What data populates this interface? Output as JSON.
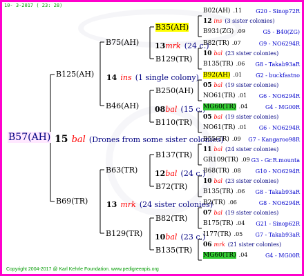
{
  "header": {
    "date": "10-  3-2017 ( 23: 28)"
  },
  "footer": {
    "text": "Copyright 2004-2017 @ Karl Kehrle Foundation.   www.pedigreeapis.org"
  },
  "root": {
    "id": "B57(AH)",
    "mating": {
      "year": "15",
      "type": "bal",
      "note": "(Drones from some sister colonies)"
    }
  },
  "gen1": [
    {
      "id": "B125(AH)",
      "mating": {
        "year": "14",
        "type": "ins",
        "note": "(1 single colony)"
      }
    },
    {
      "id": "B69(TR)",
      "mating": {
        "year": "13",
        "type": "mrk",
        "note": "(24 sister colonies)"
      }
    }
  ],
  "gen2": [
    {
      "id": "B75(AH)",
      "mating": {
        "year": "13",
        "type": "mrk",
        "note": "(24 c.)"
      }
    },
    {
      "id": "B46(AH)",
      "mating": {
        "year": "08",
        "type": "bal",
        "note": "(15 c.)"
      }
    },
    {
      "id": "B63(TR)",
      "mating": {
        "year": "12",
        "type": "bal",
        "note": "(24 c.)"
      }
    },
    {
      "id": "B129(TR)",
      "mating": {
        "year": "10",
        "type": "bal",
        "note": "(23 c.)"
      }
    }
  ],
  "gen3": [
    {
      "id": "B35(AH)"
    },
    {
      "id": "B129(TR)"
    },
    {
      "id": "B250(AH)"
    },
    {
      "id": "B110(TR)"
    },
    {
      "id": "B137(TR)"
    },
    {
      "id": "B72(TR)"
    },
    {
      "id": "B82(TR)"
    },
    {
      "id": "B135(TR)"
    }
  ],
  "gen4": [
    {
      "kind": "bee",
      "id": "B02(AH)",
      "n": ".11",
      "breeder": "G20 - Sinop72R",
      "hl": ""
    },
    {
      "kind": "mate",
      "year": "12",
      "type": "ins",
      "note": "(3 sister colonies)"
    },
    {
      "kind": "bee",
      "id": "B931(ZG)",
      "n": ".09",
      "breeder": "G5 - B40(ZG)",
      "hl": ""
    },
    {
      "kind": "bee",
      "id": "B82(TR)",
      "n": ".07",
      "breeder": "G9 - NO6294R",
      "hl": ""
    },
    {
      "kind": "mate",
      "year": "10",
      "type": "bal",
      "note": "(23 sister colonies)"
    },
    {
      "kind": "bee",
      "id": "B135(TR)",
      "n": ".06",
      "breeder": "G8 - Takab93aR",
      "hl": ""
    },
    {
      "kind": "bee",
      "id": "B92(AH)",
      "n": ".01",
      "breeder": "G2 - buckfastno",
      "hl": "yellow"
    },
    {
      "kind": "mate",
      "year": "05",
      "type": "bal",
      "note": "(19 sister colonies)"
    },
    {
      "kind": "bee",
      "id": "NO61(TR)",
      "n": ".01",
      "breeder": "G6 - NO6294R",
      "hl": ""
    },
    {
      "kind": "bee",
      "id": "MG60(TR)",
      "n": ".04",
      "breeder": "G4 - MG00R",
      "hl": "green"
    },
    {
      "kind": "mate",
      "year": "05",
      "type": "bal",
      "note": "(19 sister colonies)"
    },
    {
      "kind": "bee",
      "id": "NO61(TR)",
      "n": ".01",
      "breeder": "G6 - NO6294R",
      "hl": ""
    },
    {
      "kind": "bee",
      "id": "B55(TR)",
      "n": ".09",
      "breeder": "G7 - Kangaroo98R",
      "hl": ""
    },
    {
      "kind": "mate",
      "year": "11",
      "type": "bal",
      "note": "(24 sister colonies)"
    },
    {
      "kind": "bee",
      "id": "GR109(TR)",
      "n": ".09",
      "breeder": "G3 - Gr.R.mounta",
      "hl": ""
    },
    {
      "kind": "bee",
      "id": "B68(TR)",
      "n": ".08",
      "breeder": "G10 - NO6294R",
      "hl": ""
    },
    {
      "kind": "mate",
      "year": "10",
      "type": "bal",
      "note": "(23 sister colonies)"
    },
    {
      "kind": "bee",
      "id": "B135(TR)",
      "n": ".06",
      "breeder": "G8 - Takab93aR",
      "hl": ""
    },
    {
      "kind": "bee",
      "id": "B2(TR)",
      "n": ".06",
      "breeder": "G8 - NO6294R",
      "hl": ""
    },
    {
      "kind": "mate",
      "year": "07",
      "type": "bal",
      "note": "(19 sister colonies)"
    },
    {
      "kind": "bee",
      "id": "B175(TR)",
      "n": ".04",
      "breeder": "G21 - Sinop62R",
      "hl": ""
    },
    {
      "kind": "bee",
      "id": "I177(TR)",
      "n": ".05",
      "breeder": "G7 - Takab93aR",
      "hl": ""
    },
    {
      "kind": "mate",
      "year": "06",
      "type": "mrk",
      "note": "(21 sister colonies)"
    },
    {
      "kind": "bee",
      "id": "MG60(TR)",
      "n": ".04",
      "breeder": "G4 - MG00R",
      "hl": "green"
    }
  ]
}
